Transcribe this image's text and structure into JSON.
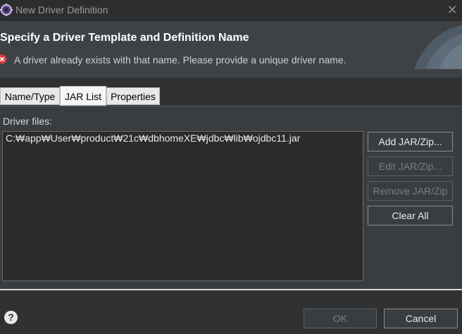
{
  "window": {
    "title": "New Driver Definition",
    "icon": "eclipse-gear-icon",
    "close_icon": "close-icon"
  },
  "header": {
    "title": "Specify a Driver Template and Definition Name",
    "message": "A driver already exists with that name. Please provide a unique driver name.",
    "message_icon": "error-icon"
  },
  "tabs": [
    {
      "label": "Name/Type",
      "active": false
    },
    {
      "label": "JAR List",
      "active": true
    },
    {
      "label": "Properties",
      "active": false
    }
  ],
  "jar_list": {
    "label": "Driver files:",
    "files": [
      "C:₩app₩User₩product₩21c₩dbhomeXE₩jdbc₩lib₩ojdbc11.jar"
    ],
    "buttons": {
      "add": "Add JAR/Zip...",
      "edit": "Edit JAR/Zip...",
      "remove": "Remove JAR/Zip",
      "clear": "Clear All"
    }
  },
  "footer": {
    "help_icon": "help-icon",
    "ok": "OK",
    "cancel": "Cancel"
  },
  "colors": {
    "background": "#2f3133",
    "header": "#3e4245",
    "error": "#e03c3c"
  }
}
